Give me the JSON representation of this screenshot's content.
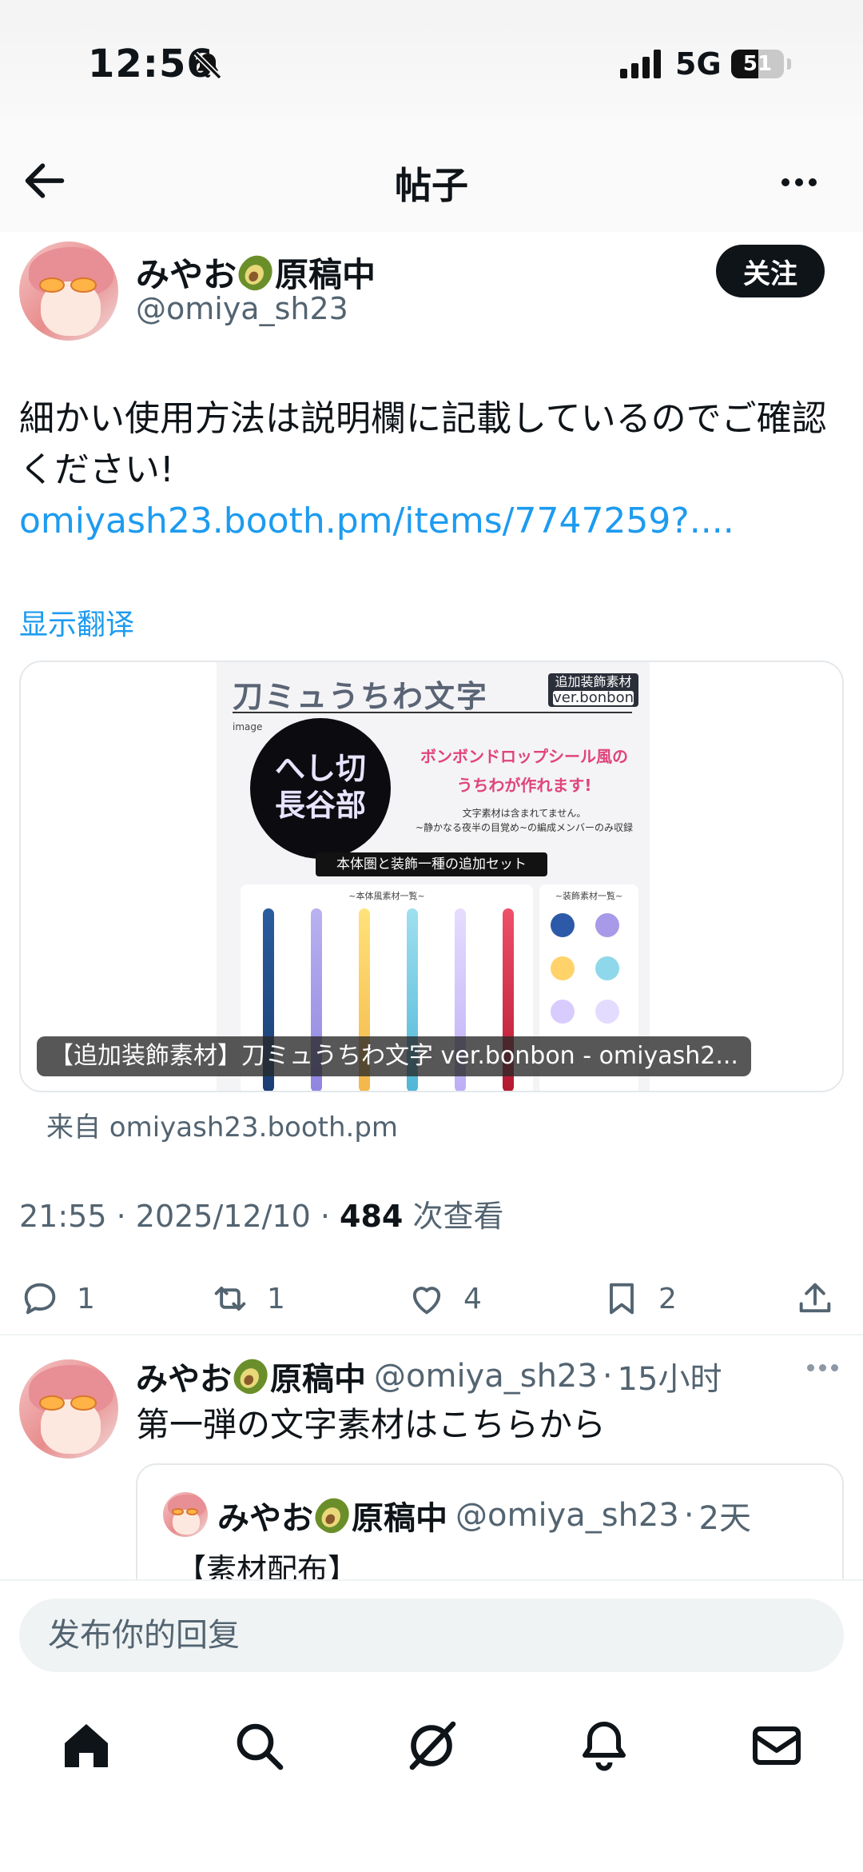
{
  "status_bar": {
    "time": "12:56",
    "network": "5G",
    "battery": "51",
    "battery_level": 0.51,
    "signal_bars": 4
  },
  "nav": {
    "title": "帖子"
  },
  "author": {
    "name_before": "みやお",
    "name_after": "原稿中",
    "handle": "@omiya_sh23",
    "follow_label": "关注"
  },
  "post": {
    "text": "細かい使用方法は説明欄に記載しているのでご確認ください!",
    "link": "omiyash23.booth.pm/items/7747259?....",
    "translate": "显示翻译"
  },
  "card": {
    "image": {
      "title": "刀ミュうちわ文字",
      "badge_top": "追加装飾素材",
      "badge_sub": "ver.bonbon",
      "small_label": "image",
      "circle_text_1": "へし切",
      "circle_text_2": "長谷部",
      "pink_line_1": "ボンボンドロップシール風の",
      "pink_line_2": "うちわが作れます!",
      "note_1": "文字素材は含まれてません。",
      "note_2": "~静かなる夜半の目覚め~の編成メンバーのみ収録",
      "banner": "本体圏と装飾一種の追加セット",
      "panel_left_title": "~本体風素材一覧~",
      "panel_right_title": "~装飾素材一覧~"
    },
    "caption": "【追加装飾素材】刀ミュうちわ文字 ver.bonbon - omiyash2...",
    "source": "来自 omiyash23.booth.pm"
  },
  "meta": {
    "time": "21:55",
    "date": "2025/12/10",
    "views": "484",
    "views_label": "次查看",
    "sep": " · "
  },
  "actions": {
    "replies": "1",
    "reposts": "1",
    "likes": "4",
    "bookmarks": "2"
  },
  "reply": {
    "name_before": "みやお",
    "name_after": "原稿中",
    "handle": "@omiya_sh23",
    "time": "15小时",
    "text": "第一弾の文字素材はこちらから",
    "quote": {
      "name_before": "みやお",
      "name_after": "原稿中",
      "handle": "@omiya_sh23",
      "time": "2天",
      "text": "【素材配布】"
    }
  },
  "reply_bar": {
    "placeholder": "发布你的回复"
  },
  "tab_bar": {
    "icons": [
      "home-icon",
      "search-icon",
      "grok-icon",
      "notifications-icon",
      "messages-icon"
    ]
  }
}
